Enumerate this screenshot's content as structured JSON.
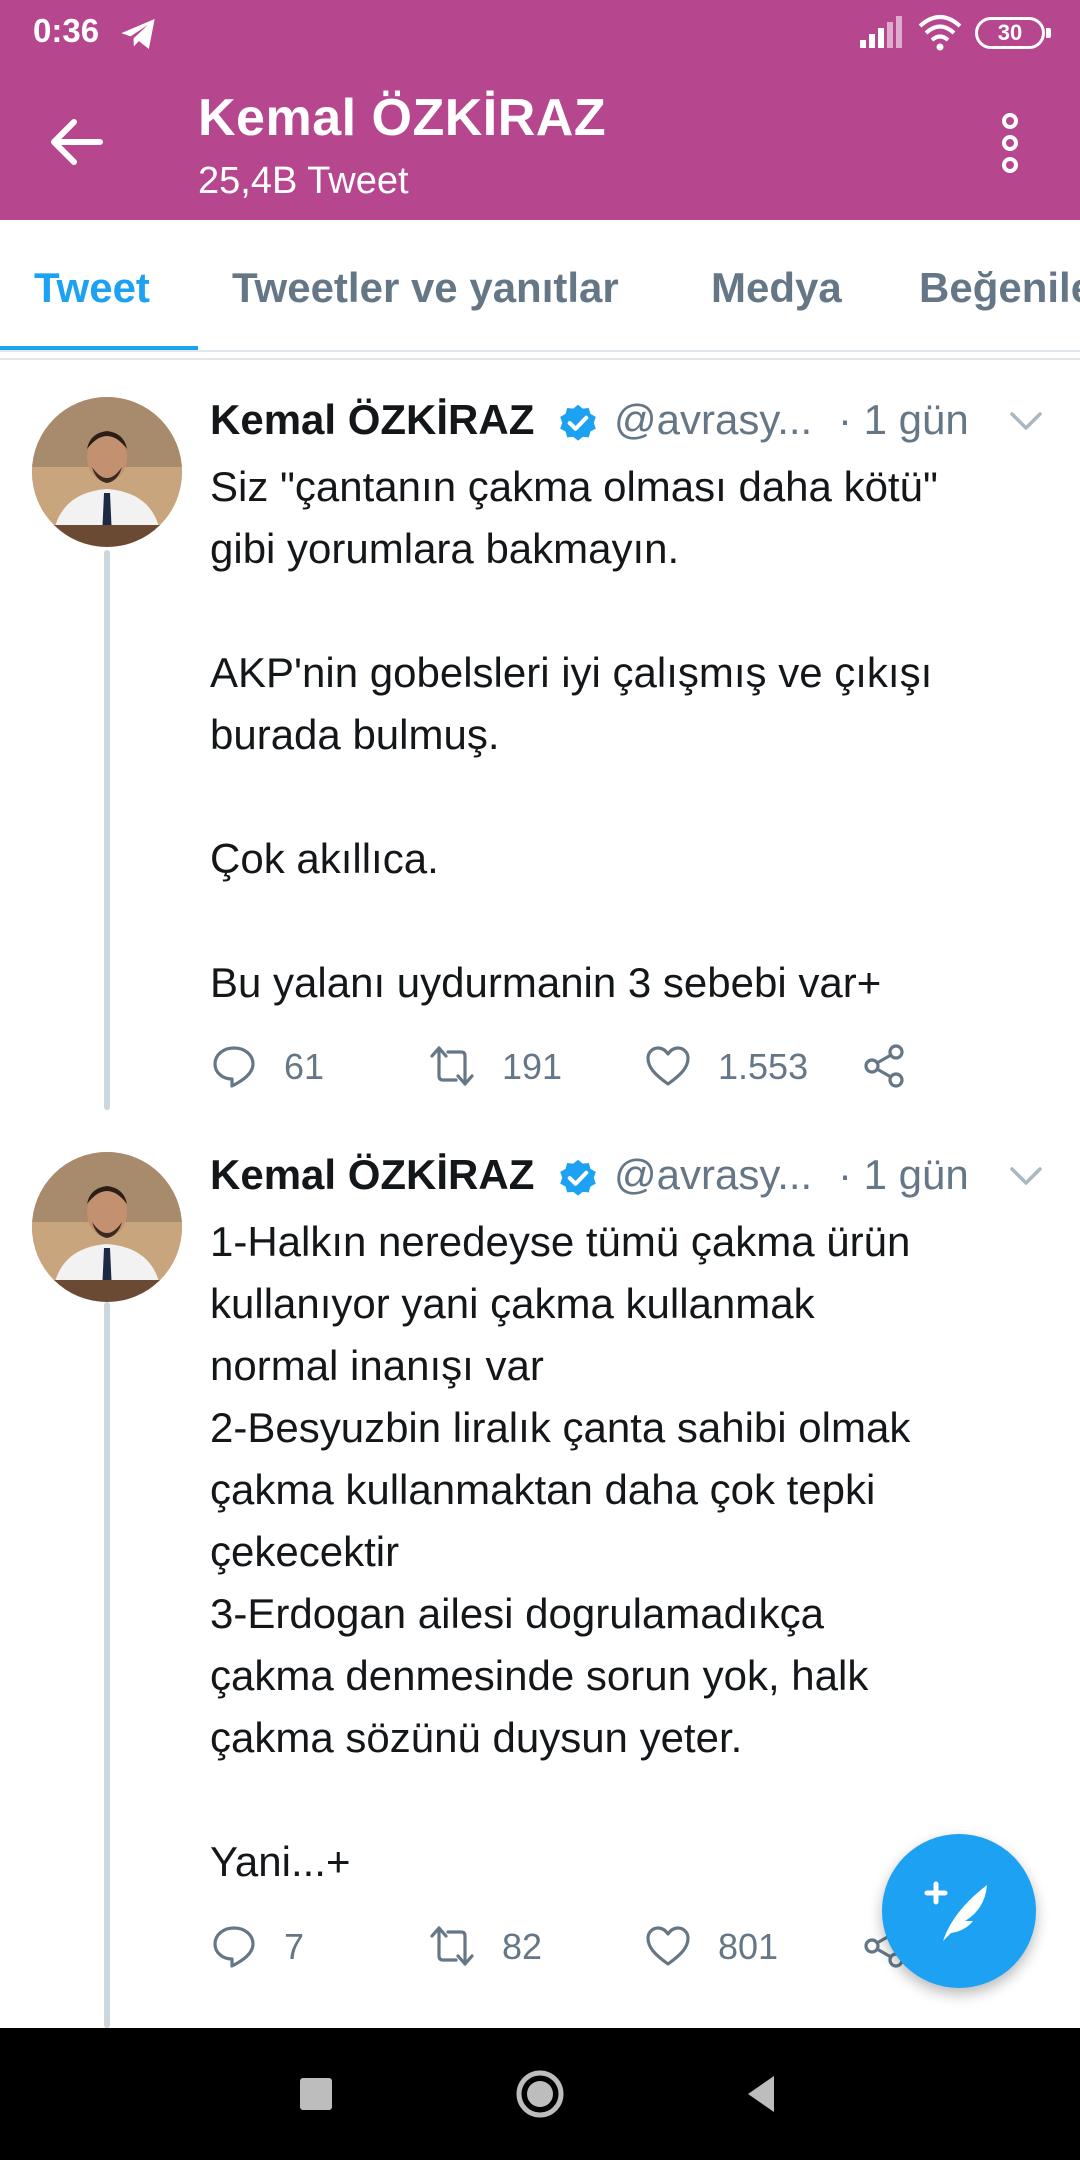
{
  "status_bar": {
    "time": "0:36",
    "battery": "30",
    "icons": [
      "telegram-icon",
      "signal-icon",
      "wifi-icon",
      "battery-icon"
    ]
  },
  "app_bar": {
    "title": "Kemal ÖZKİRAZ",
    "subtitle": "25,4B Tweet",
    "background": "#b6478f"
  },
  "tabs": [
    {
      "label": "Tweet",
      "active": true
    },
    {
      "label": "Tweetler ve yanıtlar",
      "active": false
    },
    {
      "label": "Medya",
      "active": false
    },
    {
      "label": "Beğenile",
      "active": false
    }
  ],
  "accent_color": "#1da1f2",
  "tweets": [
    {
      "name": "Kemal ÖZKİRAZ",
      "handle": "@avrasy...",
      "time": "· 1 gün",
      "lines": [
        "Siz \"çantanın çakma olması daha kötü\"",
        "gibi yorumlara bakmayın.",
        "",
        "AKP'nin gobelsleri iyi çalışmış ve çıkışı",
        "burada bulmuş.",
        "",
        "Çok akıllıca.",
        "",
        "Bu yalanı uydurmanin 3 sebebi var+"
      ],
      "replies": "61",
      "retweets": "191",
      "likes": "1.553"
    },
    {
      "name": "Kemal ÖZKİRAZ",
      "handle": "@avrasy...",
      "time": "· 1 gün",
      "lines": [
        "1-Halkın neredeyse tümü çakma ürün",
        "kullanıyor yani çakma kullanmak",
        "normal inanışı var",
        "2-Besyuzbin liralık çanta sahibi olmak",
        "çakma kullanmaktan daha çok tepki",
        "çekecektir",
        "3-Erdogan ailesi dogrulamadıkça",
        "çakma denmesinde sorun yok, halk",
        "çakma sözünü duysun yeter.",
        "",
        "Yani...+"
      ],
      "replies": "7",
      "retweets": "82",
      "likes": "801"
    }
  ]
}
